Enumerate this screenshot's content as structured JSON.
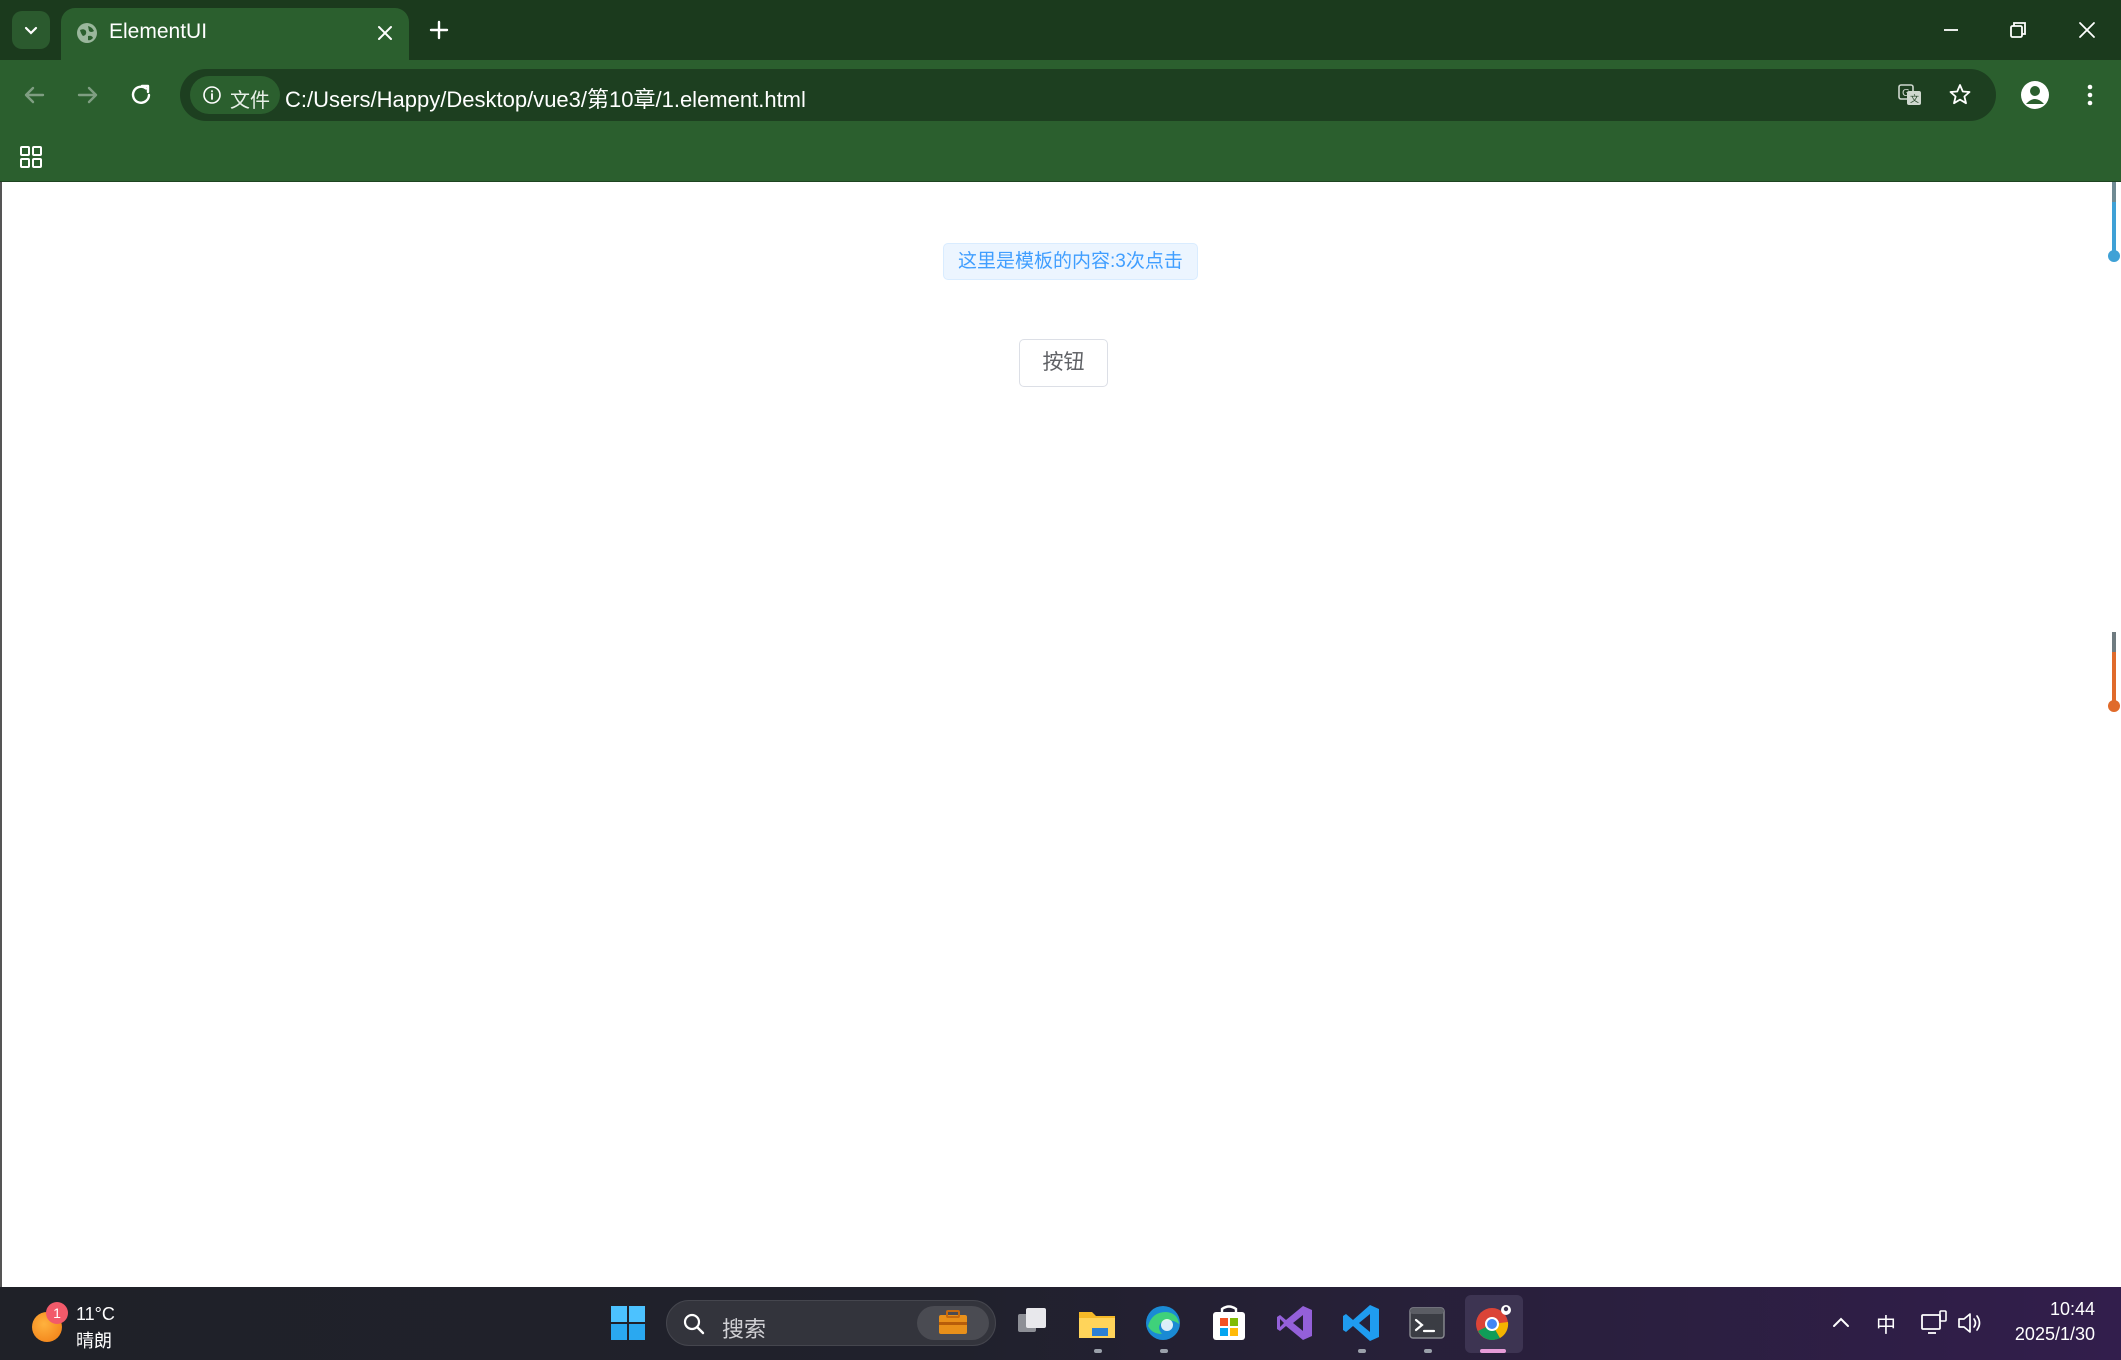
{
  "browser": {
    "tab_title": "ElementUI",
    "site_chip_label": "文件",
    "url": "C:/Users/Happy/Desktop/vue3/第10章/1.element.html"
  },
  "page": {
    "tag_text": "这里是模板的内容:3次点击",
    "button_label": "按钮"
  },
  "taskbar": {
    "weather": {
      "badge": "1",
      "temperature": "11°C",
      "condition": "晴朗"
    },
    "search_label": "搜索",
    "ime_label": "中",
    "time": "10:44",
    "date": "2025/1/30"
  },
  "colors": {
    "chrome_dark": "#1b3a1d",
    "chrome_toolbar": "#2b5f2e",
    "tag_text": "#409eff",
    "tag_bg": "#ecf5ff"
  }
}
